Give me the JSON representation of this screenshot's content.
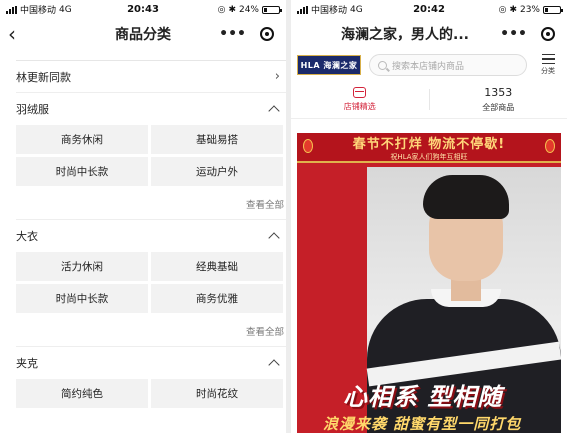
{
  "left_phone": {
    "status": {
      "carrier": "中国移动",
      "network": "4G",
      "time": "20:43",
      "battery": "24%",
      "battery_level": 0.24
    },
    "nav": {
      "title": "商品分类",
      "more": "•••"
    },
    "rows": {
      "new_arrivals": "林更新同款",
      "down": {
        "title": "羽绒服",
        "items": [
          "商务休闲",
          "基础易搭",
          "时尚中长款",
          "运动户外"
        ],
        "see_all": "查看全部"
      },
      "coat": {
        "title": "大衣",
        "items": [
          "活力休闲",
          "经典基础",
          "时尚中长款",
          "商务优雅"
        ],
        "see_all": "查看全部"
      },
      "jacket": {
        "title": "夹克",
        "items": [
          "简约纯色",
          "时尚花纹"
        ]
      }
    }
  },
  "right_phone": {
    "status": {
      "carrier": "中国移动",
      "network": "4G",
      "time": "20:42",
      "battery": "23%",
      "battery_level": 0.23
    },
    "nav": {
      "title": "海澜之家，男人的...",
      "more": "•••"
    },
    "store": {
      "logo": "HLA 海澜之家",
      "search_placeholder": "搜索本店铺内商品",
      "category_label": "分类"
    },
    "tabs": {
      "featured": "店铺精选",
      "count": "1353",
      "all_goods": "全部商品"
    },
    "banner": {
      "headline": "春节不打烊 物流不停歇!",
      "subline": "祝HLA家人们狗年互相旺",
      "slogan_main": "心相系 型相随",
      "slogan_sub": "浪漫来袭 甜蜜有型一同打包"
    }
  },
  "colors": {
    "accent_red": "#d3233a",
    "banner_red": "#c51f28",
    "brand_navy": "#1b2a6b",
    "gold": "#ffd77a"
  }
}
